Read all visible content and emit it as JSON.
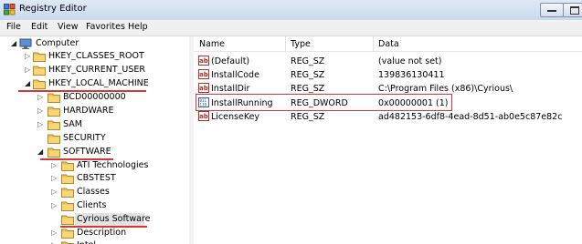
{
  "window": {
    "title": "Registry Editor"
  },
  "menu": [
    "File",
    "Edit",
    "View",
    "Favorites",
    "Help"
  ],
  "tree": [
    {
      "label": "Computer",
      "state": "open"
    },
    {
      "label": "HKEY_CLASSES_ROOT",
      "state": "closed"
    },
    {
      "label": "HKEY_CURRENT_USER",
      "state": "closed"
    },
    {
      "label": "HKEY_LOCAL_MACHINE",
      "state": "open",
      "highlighted": true
    },
    {
      "label": "BCD00000000",
      "state": "closed"
    },
    {
      "label": "HARDWARE",
      "state": "closed"
    },
    {
      "label": "SAM",
      "state": "closed"
    },
    {
      "label": "SECURITY",
      "state": "none"
    },
    {
      "label": "SOFTWARE",
      "state": "open",
      "highlighted": true
    },
    {
      "label": "ATI Technologies",
      "state": "closed"
    },
    {
      "label": "CBSTEST",
      "state": "closed"
    },
    {
      "label": "Classes",
      "state": "closed"
    },
    {
      "label": "Clients",
      "state": "closed"
    },
    {
      "label": "Cyrious Software",
      "state": "none",
      "selected": true,
      "highlighted": true
    },
    {
      "label": "Description",
      "state": "closed"
    },
    {
      "label": "Intel",
      "state": "closed"
    }
  ],
  "columns": {
    "name": "Name",
    "type": "Type",
    "data": "Data"
  },
  "values": [
    {
      "icon": "string-value-icon",
      "name": "(Default)",
      "type": "REG_SZ",
      "data": "(value not set)"
    },
    {
      "icon": "string-value-icon",
      "name": "InstallCode",
      "type": "REG_SZ",
      "data": "139836130411"
    },
    {
      "icon": "string-value-icon",
      "name": "InstallDir",
      "type": "REG_SZ",
      "data": "C:\\Program Files (x86)\\Cyrious\\"
    },
    {
      "icon": "dword-value-icon",
      "name": "InstallRunning",
      "type": "REG_DWORD",
      "data": "0x00000001 (1)",
      "highlighted": true
    },
    {
      "icon": "string-value-icon",
      "name": "LicenseKey",
      "type": "REG_SZ",
      "data": "ad482153-6df8-4ead-8d51-ab0e5c87e82c"
    }
  ],
  "colors": {
    "annotation": "#d23a3a",
    "folder": "#e8c25a"
  }
}
